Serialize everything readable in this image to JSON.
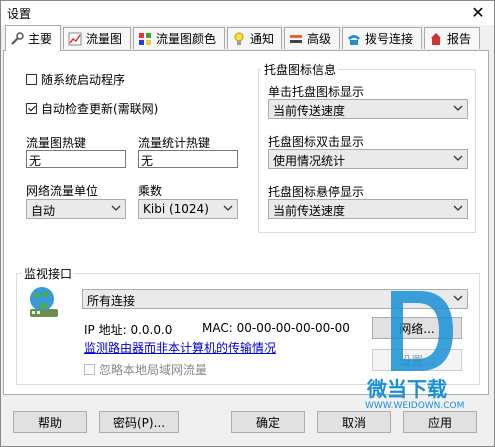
{
  "window": {
    "title": "设置",
    "close_glyph": "✕"
  },
  "tabs": [
    {
      "label": "主要",
      "icon": "wrench-icon"
    },
    {
      "label": "流量图",
      "icon": "chart-icon"
    },
    {
      "label": "流量图颜色",
      "icon": "palette-icon"
    },
    {
      "label": "通知",
      "icon": "bulb-icon"
    },
    {
      "label": "高级",
      "icon": "advanced-icon"
    },
    {
      "label": "拨号连接",
      "icon": "phone-icon"
    },
    {
      "label": "报告",
      "icon": "report-icon"
    }
  ],
  "main": {
    "startup_label": "随系统启动程序",
    "startup_checked": false,
    "autoupdate_label": "自动检查更新(需联网)",
    "autoupdate_checked": true,
    "hotkey_graph_label": "流量图热键",
    "hotkey_graph_value": "无",
    "hotkey_stats_label": "流量统计热键",
    "hotkey_stats_value": "无",
    "unit_label": "网络流量单位",
    "unit_value": "自动",
    "multiplier_label": "乘数",
    "multiplier_value": "Kibi (1024)"
  },
  "tray": {
    "title": "托盘图标信息",
    "single_click_label": "单击托盘图标显示",
    "single_click_value": "当前传送速度",
    "double_click_label": "托盘图标双击显示",
    "double_click_value": "使用情况统计",
    "hover_label": "托盘图标悬停显示",
    "hover_value": "当前传送速度"
  },
  "monitor": {
    "title": "监视接口",
    "interface_value": "所有连接",
    "ip_text": "IP 地址: 0.0.0.0",
    "mac_text": "MAC: 00-00-00-00-00-00",
    "router_link": "监测路由器而非本计算机的传输情况",
    "ignore_lan_label": "忽略本地局域网流量",
    "network_button": "网络...",
    "settings_button": "设置..."
  },
  "footer": {
    "help": "帮助",
    "password": "密码(P)...",
    "ok": "确定",
    "cancel": "取消",
    "apply": "应用"
  },
  "watermark": {
    "brand": "微当下载",
    "url": "WWW.WEIDOWN.COM",
    "accent": "#1a8fd6"
  }
}
